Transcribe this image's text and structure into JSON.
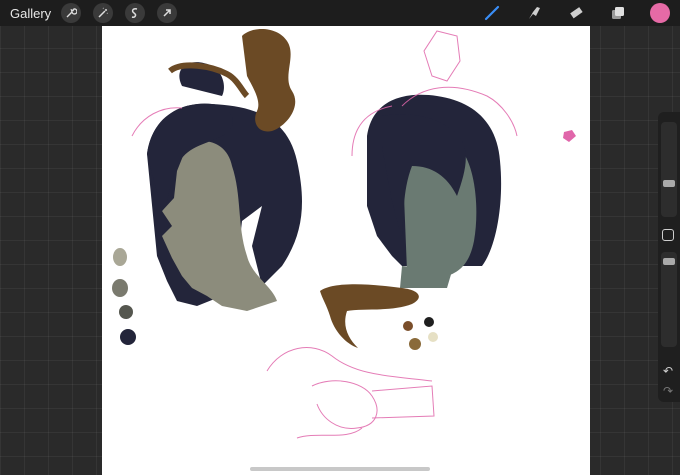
{
  "topbar": {
    "gallery_label": "Gallery",
    "left_icons": [
      "wrench-icon",
      "magic-wand-icon",
      "selection-icon",
      "transform-arrow-icon"
    ],
    "right_icons": [
      "brush-icon",
      "smudge-icon",
      "eraser-icon",
      "layers-icon"
    ],
    "current_color": "#e66aa6"
  },
  "sidebar": {
    "brush_size_level": 0.65,
    "opacity_level": 0.25,
    "undo_icon": "undo-icon",
    "redo_icon": "redo-icon"
  },
  "canvas": {
    "background": "#ffffff",
    "swatches_left": [
      "#a9a796",
      "#7a7a6e",
      "#55574f",
      "#23253a"
    ],
    "swatches_right": [
      "#7a4e2a",
      "#1f1f1f",
      "#8a6a3a",
      "#e6e0c4"
    ]
  }
}
